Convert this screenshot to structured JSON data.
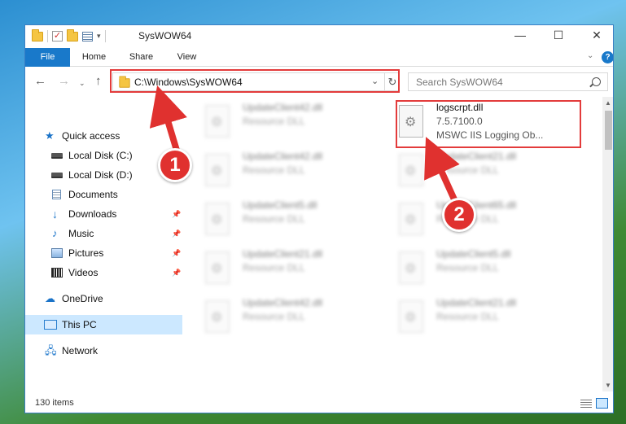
{
  "window": {
    "title": "SysWOW64",
    "controls": {
      "minimize": "—",
      "maximize": "☐",
      "close": "✕"
    }
  },
  "ribbon": {
    "tabs": [
      "File",
      "Home",
      "Share",
      "View"
    ]
  },
  "nav": {
    "address": "C:\\Windows\\SysWOW64",
    "search_placeholder": "Search SysWOW64"
  },
  "sidebar": {
    "items": [
      {
        "label": "Quick access",
        "icon": "star-icon"
      },
      {
        "label": "Local Disk (C:)",
        "icon": "disk-icon"
      },
      {
        "label": "Local Disk (D:)",
        "icon": "disk-icon"
      },
      {
        "label": "Documents",
        "icon": "documents-icon"
      },
      {
        "label": "Downloads",
        "icon": "download-icon"
      },
      {
        "label": "Music",
        "icon": "music-icon"
      },
      {
        "label": "Pictures",
        "icon": "pictures-icon"
      },
      {
        "label": "Videos",
        "icon": "videos-icon"
      },
      {
        "label": "OneDrive",
        "icon": "cloud-icon"
      },
      {
        "label": "This PC",
        "icon": "computer-icon",
        "selected": true
      },
      {
        "label": "Network",
        "icon": "network-icon"
      }
    ]
  },
  "files": {
    "highlighted": {
      "name": "logscrpt.dll",
      "version": "7.5.7100.0",
      "description": "MSWC IIS Logging Ob..."
    },
    "left_column": [
      {
        "name": "UpdateClient42.dll",
        "type": "Resource DLL"
      },
      {
        "name": "UpdateClient42.dll",
        "type": "Resource DLL"
      },
      {
        "name": "UpdateClient5.dll",
        "type": "Resource DLL"
      },
      {
        "name": "UpdateClient21.dll",
        "type": "Resource DLL"
      },
      {
        "name": "UpdateClient42.dll",
        "type": "Resource DLL"
      }
    ],
    "right_column": [
      {
        "name": "UpdateClient21.dll",
        "type": "Resource DLL"
      },
      {
        "name": "UpdateClient65.dll",
        "type": "Resource DLL"
      },
      {
        "name": "UpdateClient5.dll",
        "type": "Resource DLL"
      },
      {
        "name": "UpdateClient21.dll",
        "type": "Resource DLL"
      }
    ]
  },
  "status": {
    "item_count": "130 items"
  },
  "annotations": {
    "badge1": "1",
    "badge2": "2",
    "color": "#e0312f"
  }
}
